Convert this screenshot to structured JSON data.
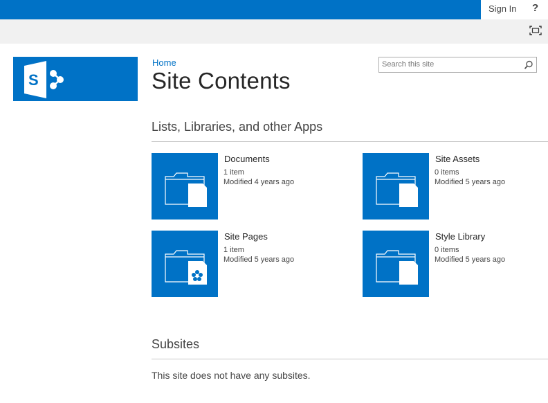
{
  "suite_bar": {
    "sign_in_label": "Sign In",
    "help_label": "?",
    "accent_color": "#0072c6"
  },
  "ribbon": {
    "focus_icon": "focus-on-content-icon"
  },
  "header": {
    "logo_icon": "sharepoint-logo-icon",
    "breadcrumb": "Home",
    "title": "Site Contents"
  },
  "search": {
    "placeholder": "Search this site",
    "icon": "search-icon"
  },
  "lists_section": {
    "heading": "Lists, Libraries, and other Apps",
    "apps": [
      {
        "name": "Documents",
        "count": "1 item",
        "modified": "Modified 4 years ago",
        "icon": "document-library-icon"
      },
      {
        "name": "Site Assets",
        "count": "0 items",
        "modified": "Modified 5 years ago",
        "icon": "document-library-icon"
      },
      {
        "name": "Site Pages",
        "count": "1 item",
        "modified": "Modified 5 years ago",
        "icon": "wiki-page-library-icon"
      },
      {
        "name": "Style Library",
        "count": "0 items",
        "modified": "Modified 5 years ago",
        "icon": "document-library-icon"
      }
    ]
  },
  "subsites_section": {
    "heading": "Subsites",
    "empty_message": "This site does not have any subsites."
  }
}
